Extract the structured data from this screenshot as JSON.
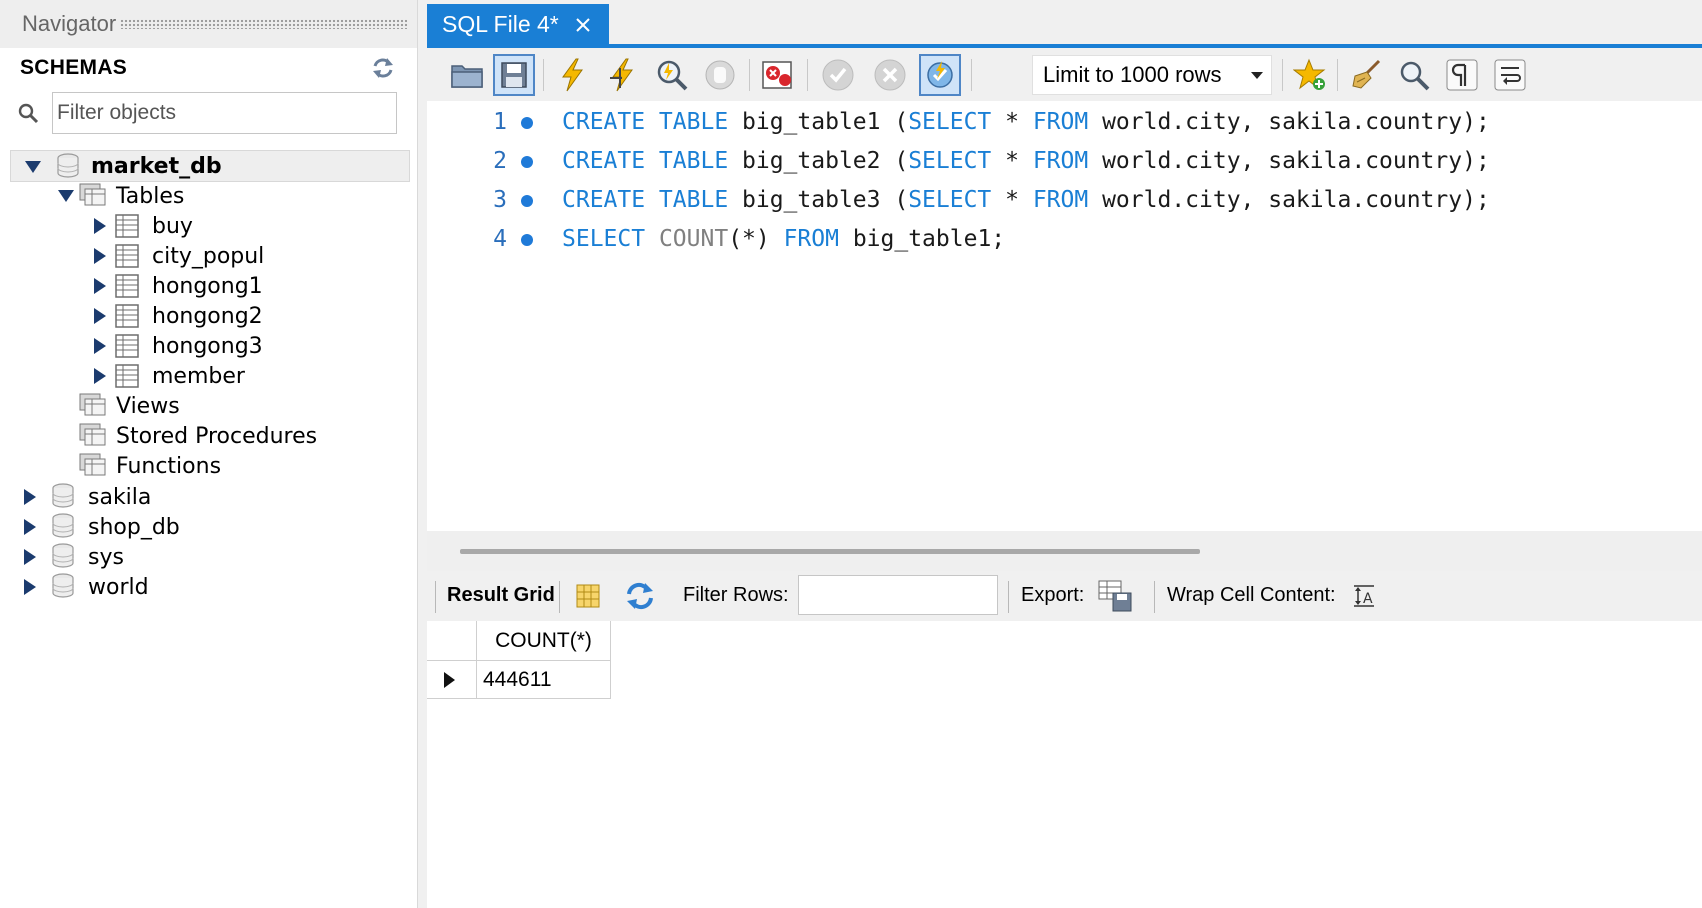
{
  "navigator": {
    "title": "Navigator",
    "schemas_title": "SCHEMAS",
    "filter_placeholder": "Filter objects",
    "tree": {
      "market_db": "market_db",
      "tables": "Tables",
      "table_items": [
        "buy",
        "city_popul",
        "hongong1",
        "hongong2",
        "hongong3",
        "member"
      ],
      "views": "Views",
      "stored_procedures": "Stored Procedures",
      "functions": "Functions",
      "other_schemas": [
        "sakila",
        "shop_db",
        "sys",
        "world"
      ]
    }
  },
  "editor_tab": {
    "label": "SQL File 4*"
  },
  "toolbar": {
    "limit_select": "Limit to 1000 rows",
    "icons": [
      "open-folder-icon",
      "save-icon",
      "execute-icon",
      "execute-current-icon",
      "explain-icon",
      "stop-icon",
      "toggle-error-icon",
      "commit-icon",
      "rollback-icon",
      "autocommit-icon",
      "bookmark-star-icon",
      "beautify-icon",
      "find-icon",
      "invisible-chars-icon",
      "wrap-icon"
    ]
  },
  "editor": {
    "lines": [
      {
        "num": "1",
        "parts": [
          [
            "kw",
            "CREATE TABLE "
          ],
          [
            "tx",
            "big_table1 ("
          ],
          [
            "kw",
            "SELECT"
          ],
          [
            "tx",
            " * "
          ],
          [
            "kw",
            "FROM"
          ],
          [
            "tx",
            " world.city, sakila.country);"
          ]
        ]
      },
      {
        "num": "2",
        "parts": [
          [
            "kw",
            "CREATE TABLE "
          ],
          [
            "tx",
            "big_table2 ("
          ],
          [
            "kw",
            "SELECT"
          ],
          [
            "tx",
            " * "
          ],
          [
            "kw",
            "FROM"
          ],
          [
            "tx",
            " world.city, sakila.country);"
          ]
        ]
      },
      {
        "num": "3",
        "parts": [
          [
            "kw",
            "CREATE TABLE "
          ],
          [
            "tx",
            "big_table3 ("
          ],
          [
            "kw",
            "SELECT"
          ],
          [
            "tx",
            " * "
          ],
          [
            "kw",
            "FROM"
          ],
          [
            "tx",
            " world.city, sakila.country);"
          ]
        ]
      },
      {
        "num": "4",
        "parts": [
          [
            "kw",
            "SELECT "
          ],
          [
            "fn",
            "COUNT"
          ],
          [
            "tx",
            "(*) "
          ],
          [
            "kw",
            "FROM"
          ],
          [
            "tx",
            " big_table1;"
          ]
        ]
      }
    ]
  },
  "result_bar": {
    "result_grid": "Result Grid",
    "filter_rows": "Filter Rows:",
    "export": "Export:",
    "wrap_cell": "Wrap Cell Content:"
  },
  "result_grid": {
    "columns": [
      "COUNT(*)"
    ],
    "rows": [
      [
        "444611"
      ]
    ]
  },
  "colors": {
    "accent": "#1a7fd5",
    "keyword": "#1a7fd5",
    "function": "#808080"
  }
}
